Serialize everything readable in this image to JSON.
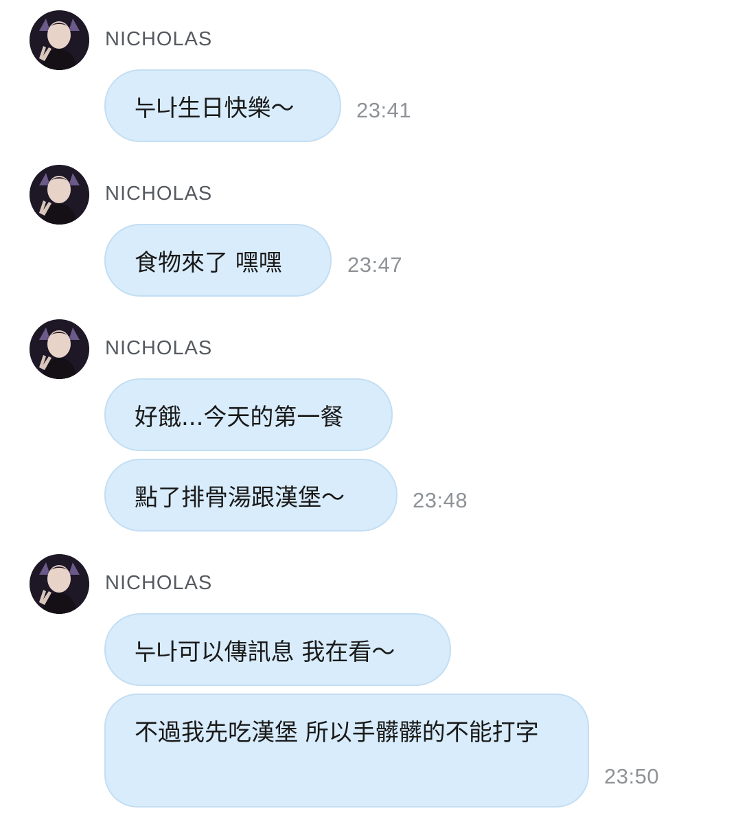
{
  "messages": [
    {
      "sender": "NICHOLAS",
      "bubbles": [
        "누나生日快樂～"
      ],
      "time": "23:41"
    },
    {
      "sender": "NICHOLAS",
      "bubbles": [
        "食物來了 嘿嘿"
      ],
      "time": "23:47"
    },
    {
      "sender": "NICHOLAS",
      "bubbles": [
        "好餓...今天的第一餐",
        "點了排骨湯跟漢堡～"
      ],
      "time": "23:48"
    },
    {
      "sender": "NICHOLAS",
      "bubbles": [
        "누나可以傳訊息 我在看～",
        "不過我先吃漢堡 所以手髒髒的不能打字"
      ],
      "time": "23:50"
    }
  ],
  "icons": {
    "avatar": "profile-photo-avatar"
  },
  "colors": {
    "bubble_fill": "#d8ecfb",
    "bubble_border": "#c3def3",
    "sender_text": "#555a60",
    "time_text": "#8e9297"
  }
}
